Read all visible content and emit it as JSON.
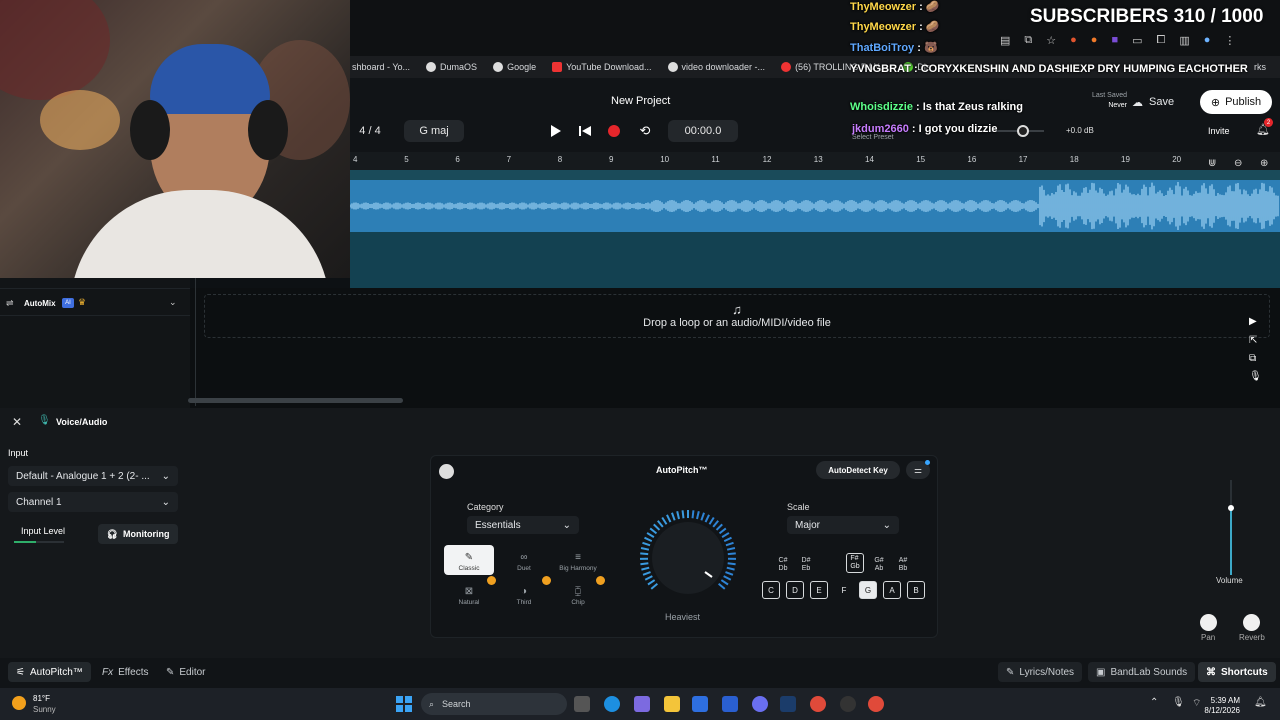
{
  "browser": {
    "bookmarks": [
      "shboard - Yo...",
      "DumaOS",
      "Google",
      "YouTube Download...",
      "video downloader -...",
      "(56) TROLLING RAN...",
      "Dis"
    ],
    "bookmarks_tail": "rks"
  },
  "header": {
    "project_title": "New Project",
    "time_signature": "4 / 4",
    "key": "G maj",
    "time": "00:00.0",
    "last_saved_label": "Last Saved",
    "last_saved_value": "Never",
    "save_label": "Save",
    "publish_label": "Publish",
    "invite_label": "Invite",
    "master_gain": "+0.0 dB",
    "select_preset": "Select Preset",
    "notif_count": "2"
  },
  "ruler": [
    "4",
    "5",
    "6",
    "7",
    "8",
    "9",
    "10",
    "11",
    "12",
    "13",
    "14",
    "15",
    "16",
    "17",
    "18",
    "19",
    "20"
  ],
  "automix": {
    "label": "AutoMix",
    "badge": "AI"
  },
  "dropzone": {
    "text": "Drop a loop or an audio/MIDI/video file"
  },
  "panel": {
    "title": "Voice/Audio",
    "input_label": "Input",
    "input_device": "Default - Analogue 1 + 2 (2- ...",
    "channel": "Channel 1",
    "input_level_label": "Input Level",
    "monitoring_label": "Monitoring",
    "autopitch_title": "AutoPitch™",
    "autodetect_label": "AutoDetect Key",
    "category_label": "Category",
    "category_value": "Essentials",
    "scale_label": "Scale",
    "scale_value": "Major",
    "voices": [
      "Classic",
      "Duet",
      "Big Harmony",
      "Natural",
      "Third",
      "Chip"
    ],
    "knob_label": "Heaviest",
    "sharps": [
      "C#\nDb",
      "D#\nEb",
      "F#\nGb",
      "G#\nAb",
      "A#\nBb"
    ],
    "keys": [
      "C",
      "D",
      "E",
      "F",
      "G",
      "A",
      "B"
    ],
    "selected_key": "G",
    "volume_label": "Volume",
    "pan_label": "Pan",
    "reverb_label": "Reverb"
  },
  "footer": {
    "tabs": [
      "AutoPitch™",
      "Effects",
      "Editor"
    ],
    "right": [
      "Lyrics/Notes",
      "BandLab Sounds",
      "Shortcuts"
    ]
  },
  "taskbar": {
    "weather_temp": "81°F",
    "weather_desc": "Sunny",
    "search_placeholder": "Search",
    "time": "5:39 AM",
    "date": "8/12/2026"
  },
  "overlay": {
    "subscribers": "SUBSCRIBERS 310 / 1000",
    "chat": [
      {
        "user": "ThyMeowzer",
        "msg": ": 🥔",
        "color": "#ffd84a"
      },
      {
        "user": "ThyMeowzer",
        "msg": ": 🥔",
        "color": "#ffd84a"
      },
      {
        "user": "ThatBoiTroy",
        "msg": ": 🐻",
        "color": "#5fa8ff"
      },
      {
        "user": "YVNGBRAT",
        "msg": ": CORYXKENSHIN AND DASHIEXP DRY HUMPING EACHOTHER",
        "color": "#ffffff"
      },
      {
        "user": "Whoisdizzie",
        "msg": ": Is that Zeus ralking",
        "color": "#5dff8a"
      },
      {
        "user": "jkdum2660",
        "msg": ": I got you dizzie",
        "color": "#c77dff"
      }
    ]
  }
}
